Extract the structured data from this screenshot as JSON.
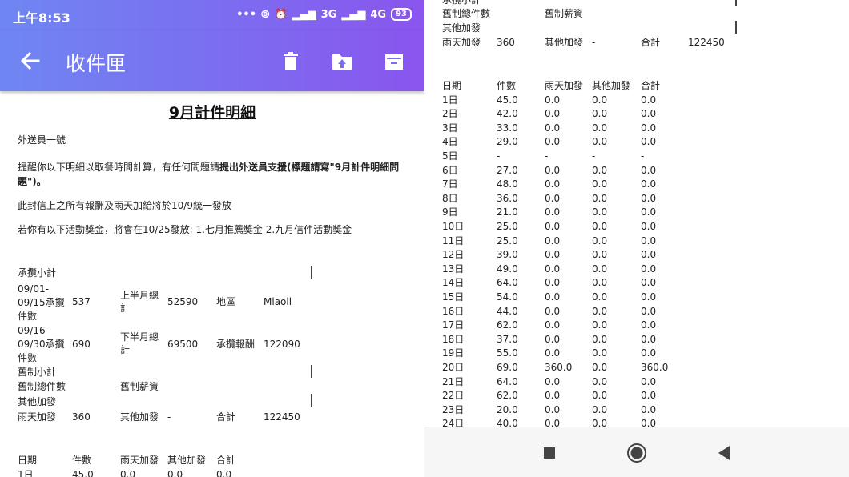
{
  "status_bar": {
    "time": "上午8:53",
    "signal_1": "3G",
    "signal_2": "4G",
    "battery": "93"
  },
  "app_bar": {
    "title": "收件匣",
    "icons": [
      "back-arrow-icon",
      "trash-icon",
      "move-to-folder-icon",
      "archive-icon"
    ]
  },
  "email": {
    "title": "9月計件明細",
    "recipient": "外送員一號",
    "reminder_prefix": "提醒你以下明細以取餐時間計算，有任何問題請",
    "reminder_bold": "提出外送員支援(標題請寫\"9月計件明細問題\")。",
    "payment_note": "此封信上之所有報酬及雨天加給將於10/9統一發放",
    "bonus_note": "若你有以下活動獎金，將會在10/25發放: 1.七月推薦獎金 2.九月信件活動獎金"
  },
  "summary": {
    "section_undertake": "承攬小計",
    "first_half_label": "09/01-09/15承攬件數",
    "first_half_count": "537",
    "first_half_total_label": "上半月總計",
    "first_half_total": "52590",
    "region_label": "地區",
    "region": "Miaoli",
    "second_half_label": "09/16-09/30承攬件數",
    "second_half_count": "690",
    "second_half_total_label": "下半月總計",
    "second_half_total": "69500",
    "undertake_pay_label": "承攬報酬",
    "undertake_pay": "122090",
    "section_legacy": "舊制小計",
    "legacy_count_label": "舊制總件數",
    "legacy_salary_label": "舊制薪資",
    "section_extra": "其他加發",
    "rain_bonus_label": "雨天加發",
    "rain_bonus": "360",
    "other_bonus_label": "其他加發",
    "other_bonus": "-",
    "total_label": "合計",
    "total": "122450"
  },
  "daily_table": {
    "headers": [
      "日期",
      "件數",
      "雨天加發",
      "其他加發",
      "合計"
    ],
    "rows": [
      [
        "1日",
        "45.0",
        "0.0",
        "0.0",
        "0.0"
      ],
      [
        "2日",
        "42.0",
        "0.0",
        "0.0",
        "0.0"
      ],
      [
        "3日",
        "33.0",
        "0.0",
        "0.0",
        "0.0"
      ],
      [
        "4日",
        "29.0",
        "0.0",
        "0.0",
        "0.0"
      ],
      [
        "5日",
        "-",
        "-",
        "-",
        "-"
      ],
      [
        "6日",
        "27.0",
        "0.0",
        "0.0",
        "0.0"
      ],
      [
        "7日",
        "48.0",
        "0.0",
        "0.0",
        "0.0"
      ],
      [
        "8日",
        "36.0",
        "0.0",
        "0.0",
        "0.0"
      ],
      [
        "9日",
        "21.0",
        "0.0",
        "0.0",
        "0.0"
      ],
      [
        "10日",
        "25.0",
        "0.0",
        "0.0",
        "0.0"
      ],
      [
        "11日",
        "25.0",
        "0.0",
        "0.0",
        "0.0"
      ],
      [
        "12日",
        "39.0",
        "0.0",
        "0.0",
        "0.0"
      ],
      [
        "13日",
        "49.0",
        "0.0",
        "0.0",
        "0.0"
      ],
      [
        "14日",
        "64.0",
        "0.0",
        "0.0",
        "0.0"
      ],
      [
        "15日",
        "54.0",
        "0.0",
        "0.0",
        "0.0"
      ],
      [
        "16日",
        "44.0",
        "0.0",
        "0.0",
        "0.0"
      ],
      [
        "17日",
        "62.0",
        "0.0",
        "0.0",
        "0.0"
      ],
      [
        "18日",
        "37.0",
        "0.0",
        "0.0",
        "0.0"
      ],
      [
        "19日",
        "55.0",
        "0.0",
        "0.0",
        "0.0"
      ],
      [
        "20日",
        "69.0",
        "360.0",
        "0.0",
        "360.0"
      ],
      [
        "21日",
        "64.0",
        "0.0",
        "0.0",
        "0.0"
      ],
      [
        "22日",
        "62.0",
        "0.0",
        "0.0",
        "0.0"
      ],
      [
        "23日",
        "20.0",
        "0.0",
        "0.0",
        "0.0"
      ],
      [
        "24日",
        "40.0",
        "0.0",
        "0.0",
        "0.0"
      ]
    ]
  },
  "nav_bar": {
    "icons": [
      "recent-apps-icon",
      "home-icon",
      "back-icon"
    ]
  }
}
